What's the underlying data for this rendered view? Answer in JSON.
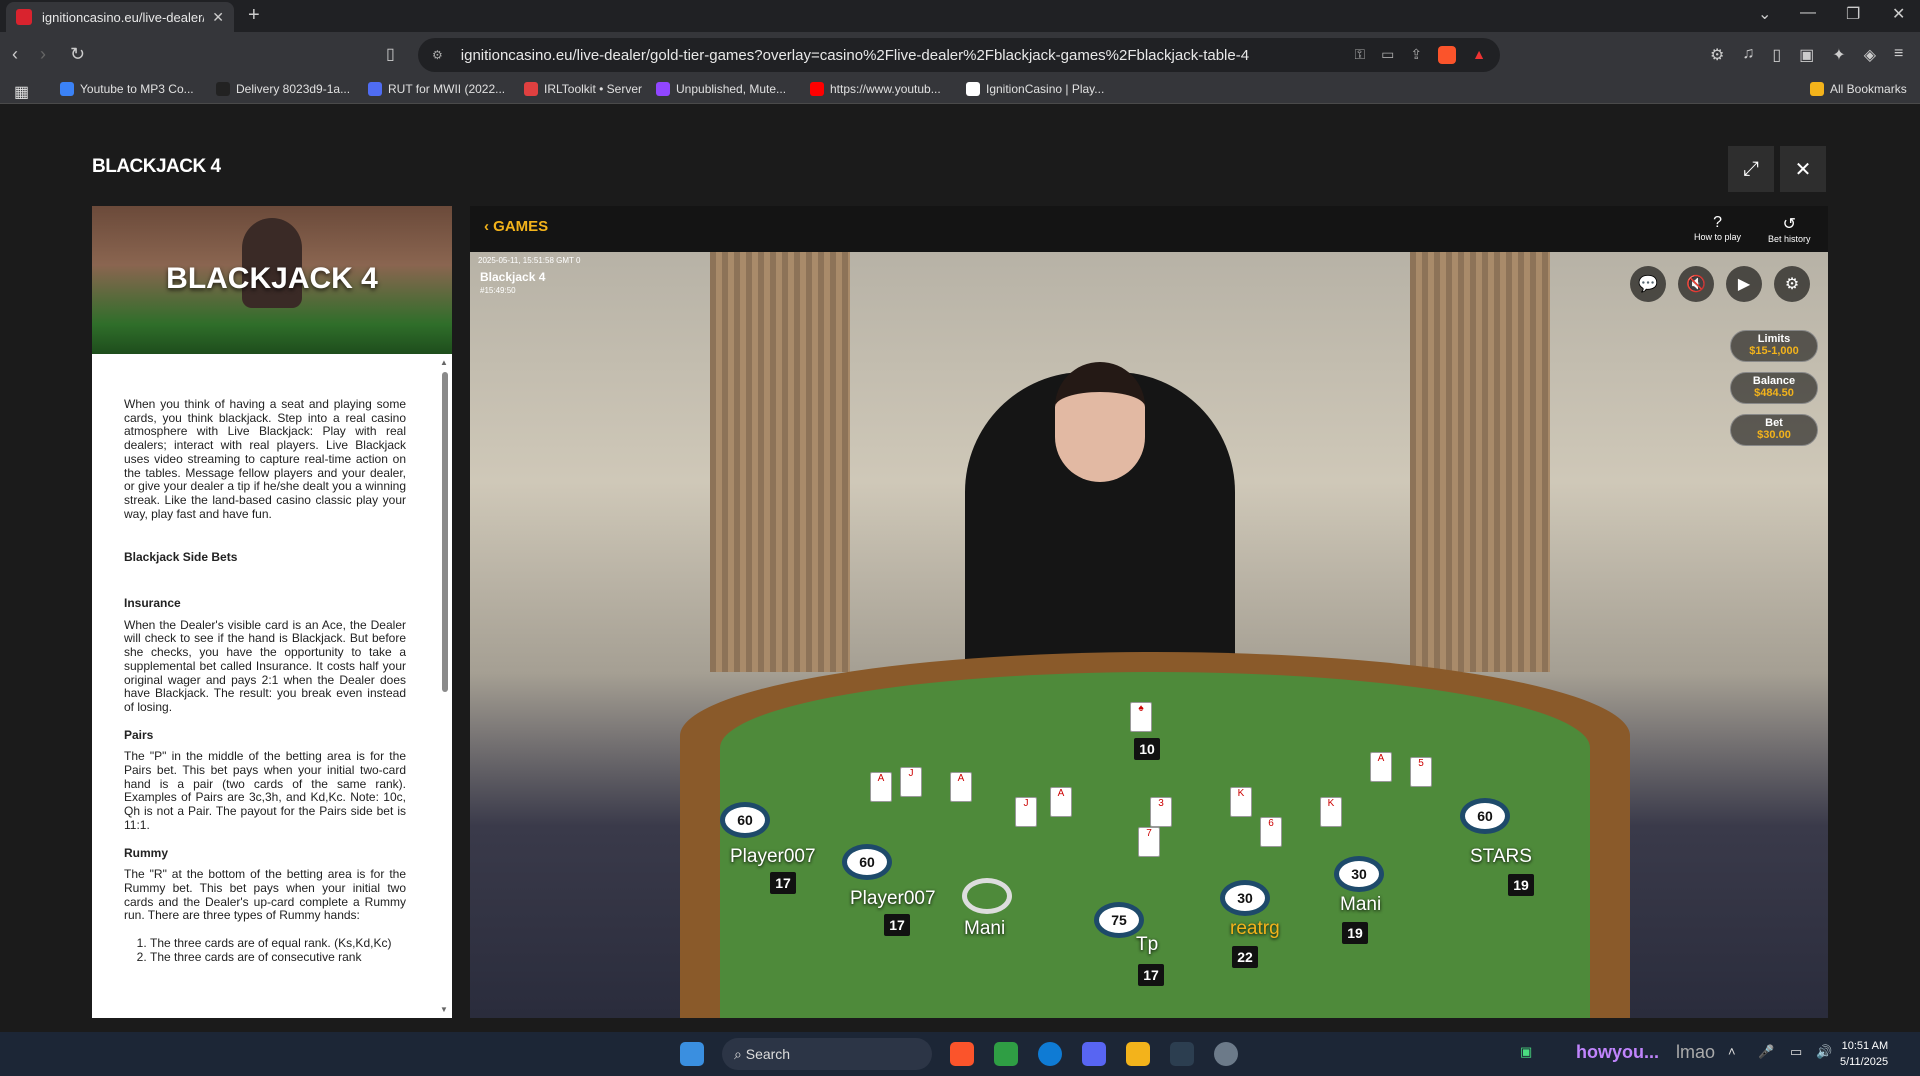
{
  "browser": {
    "tab_title": "ignitioncasino.eu/live-dealer/g",
    "url": "ignitioncasino.eu/live-dealer/gold-tier-games?overlay=casino%2Flive-dealer%2Fblackjack-games%2Fblackjack-table-4",
    "bookmarks": [
      {
        "label": "Youtube to MP3 Co...",
        "color": "#3b82f6"
      },
      {
        "label": "Delivery 8023d9-1a...",
        "color": "#222222"
      },
      {
        "label": "RUT for MWII (2022...",
        "color": "#4f6cf2"
      },
      {
        "label": "IRLToolkit • Server",
        "color": "#e04040"
      },
      {
        "label": "Unpublished, Mute...",
        "color": "#9146ff"
      },
      {
        "label": "https://www.youtub...",
        "color": "#ff0000"
      },
      {
        "label": "IgnitionCasino | Play...",
        "color": "#ffffff"
      }
    ],
    "all_bookmarks": "All Bookmarks"
  },
  "page": {
    "game_title": "BLACKJACK 4",
    "thumb_title": "BLACKJACK 4",
    "description": "When you think of having a seat and playing some cards, you think blackjack. Step into a real casino atmosphere with Live Blackjack: Play with real dealers; interact with real players. Live Blackjack uses video streaming to capture real-time action on the tables. Message fellow players and your dealer, or give your dealer a tip if he/she dealt you a winning streak. Like the land-based casino classic play your way, play fast and have fun.",
    "side_bets_heading": "Blackjack Side Bets",
    "insurance_heading": "Insurance",
    "insurance_text": "When the Dealer's visible card is an Ace, the Dealer will check to see if the hand is Blackjack. But before she checks, you have the opportunity to take a supplemental bet called Insurance. It costs half your original wager and pays 2:1 when the Dealer does have Blackjack. The result: you break even instead of losing.",
    "pairs_heading": "Pairs",
    "pairs_text": "The \"P\" in the middle of the betting area is for the Pairs bet. This bet pays when your initial two-card hand is a pair (two cards of the same rank). Examples of Pairs are 3c,3h, and Kd,Kc. Note: 10c, Qh is not a Pair. The payout for the Pairs side bet is 11:1.",
    "rummy_heading": "Rummy",
    "rummy_text": "The \"R\" at the bottom of the betting area is for the Rummy bet. This bet pays when your initial two cards and the Dealer's up-card complete a Rummy run. There are three types of Rummy hands:",
    "rummy_list": [
      "The three cards are of equal rank. (Ks,Kd,Kc)",
      "The three cards are of consecutive rank"
    ]
  },
  "game": {
    "back_label": "GAMES",
    "how_to_play": "How to play",
    "bet_history": "Bet history",
    "timestamp": "2025-05-11, 15:51:58 GMT 0",
    "table_name": "Blackjack 4",
    "round_id": "#15:49:50",
    "limits_label": "Limits",
    "limits_value": "$15-1,000",
    "balance_label": "Balance",
    "balance_value": "$484.50",
    "bet_label": "Bet",
    "bet_value": "$30.00",
    "dealer_score": "10",
    "players": [
      {
        "name": "Player007",
        "chip": "60",
        "score": "17"
      },
      {
        "name": "Player007",
        "chip": "60",
        "score": "17"
      },
      {
        "name": "Mani",
        "chip": "",
        "score": ""
      },
      {
        "name": "Tp",
        "chip": "75",
        "score": "17"
      },
      {
        "name": "reatrg",
        "chip": "30",
        "score": "22"
      },
      {
        "name": "Mani",
        "chip": "30",
        "score": "19"
      },
      {
        "name": "STARS",
        "chip": "60",
        "score": "19"
      }
    ]
  },
  "taskbar": {
    "search_placeholder": "Search",
    "tray_text": "howyou...",
    "tray_text2": "lmao",
    "time": "10:51 AM",
    "date": "5/11/2025"
  }
}
